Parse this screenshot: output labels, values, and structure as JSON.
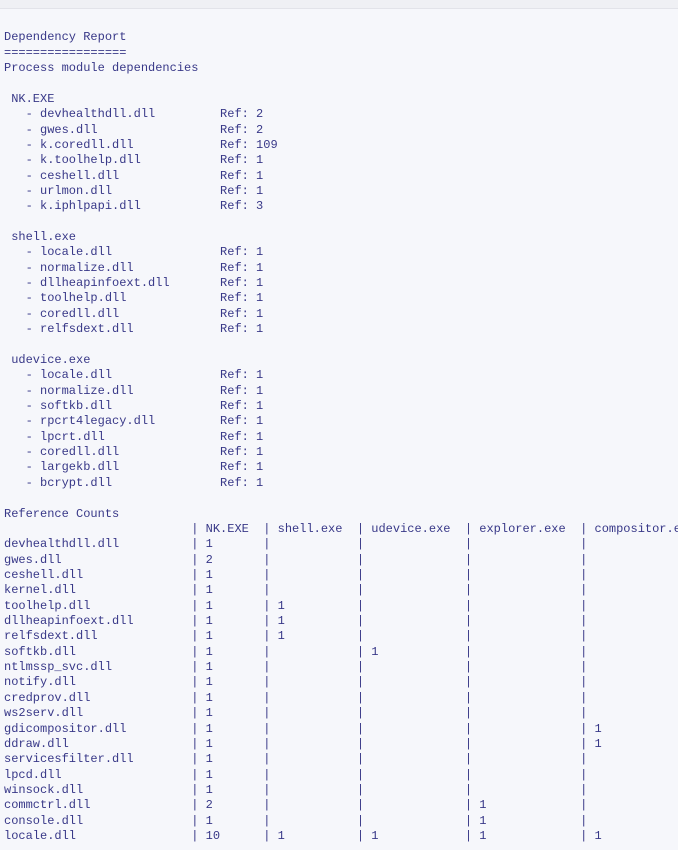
{
  "header": {
    "title": "Dependency Report",
    "divider": "=================",
    "subtitle": "Process module dependencies"
  },
  "processes": [
    {
      "name": "NK.EXE",
      "modules": [
        {
          "name": "devhealthdll.dll",
          "ref": 2
        },
        {
          "name": "gwes.dll",
          "ref": 2
        },
        {
          "name": "k.coredll.dll",
          "ref": 109
        },
        {
          "name": "k.toolhelp.dll",
          "ref": 1
        },
        {
          "name": "ceshell.dll",
          "ref": 1
        },
        {
          "name": "urlmon.dll",
          "ref": 1
        },
        {
          "name": "k.iphlpapi.dll",
          "ref": 3
        }
      ]
    },
    {
      "name": "shell.exe",
      "modules": [
        {
          "name": "locale.dll",
          "ref": 1
        },
        {
          "name": "normalize.dll",
          "ref": 1
        },
        {
          "name": "dllheapinfoext.dll",
          "ref": 1
        },
        {
          "name": "toolhelp.dll",
          "ref": 1
        },
        {
          "name": "coredll.dll",
          "ref": 1
        },
        {
          "name": "relfsdext.dll",
          "ref": 1
        }
      ]
    },
    {
      "name": "udevice.exe",
      "modules": [
        {
          "name": "locale.dll",
          "ref": 1
        },
        {
          "name": "normalize.dll",
          "ref": 1
        },
        {
          "name": "softkb.dll",
          "ref": 1
        },
        {
          "name": "rpcrt4legacy.dll",
          "ref": 1
        },
        {
          "name": "lpcrt.dll",
          "ref": 1
        },
        {
          "name": "coredll.dll",
          "ref": 1
        },
        {
          "name": "largekb.dll",
          "ref": 1
        },
        {
          "name": "bcrypt.dll",
          "ref": 1
        }
      ]
    }
  ],
  "refcounts": {
    "title": "Reference Counts",
    "columns": [
      "NK.EXE",
      "shell.exe",
      "udevice.exe",
      "explorer.exe",
      "compositor.exe"
    ],
    "rows": [
      {
        "name": "devhealthdll.dll",
        "counts": [
          1,
          null,
          null,
          null,
          null
        ]
      },
      {
        "name": "gwes.dll",
        "counts": [
          2,
          null,
          null,
          null,
          null
        ]
      },
      {
        "name": "ceshell.dll",
        "counts": [
          1,
          null,
          null,
          null,
          null
        ]
      },
      {
        "name": "kernel.dll",
        "counts": [
          1,
          null,
          null,
          null,
          null
        ]
      },
      {
        "name": "toolhelp.dll",
        "counts": [
          1,
          1,
          null,
          null,
          null
        ]
      },
      {
        "name": "dllheapinfoext.dll",
        "counts": [
          1,
          1,
          null,
          null,
          null
        ]
      },
      {
        "name": "relfsdext.dll",
        "counts": [
          1,
          1,
          null,
          null,
          null
        ]
      },
      {
        "name": "softkb.dll",
        "counts": [
          1,
          null,
          1,
          null,
          null
        ]
      },
      {
        "name": "ntlmssp_svc.dll",
        "counts": [
          1,
          null,
          null,
          null,
          null
        ]
      },
      {
        "name": "notify.dll",
        "counts": [
          1,
          null,
          null,
          null,
          null
        ]
      },
      {
        "name": "credprov.dll",
        "counts": [
          1,
          null,
          null,
          null,
          null
        ]
      },
      {
        "name": "ws2serv.dll",
        "counts": [
          1,
          null,
          null,
          null,
          null
        ]
      },
      {
        "name": "gdicompositor.dll",
        "counts": [
          1,
          null,
          null,
          null,
          1
        ]
      },
      {
        "name": "ddraw.dll",
        "counts": [
          1,
          null,
          null,
          null,
          1
        ]
      },
      {
        "name": "servicesfilter.dll",
        "counts": [
          1,
          null,
          null,
          null,
          null
        ]
      },
      {
        "name": "lpcd.dll",
        "counts": [
          1,
          null,
          null,
          null,
          null
        ]
      },
      {
        "name": "winsock.dll",
        "counts": [
          1,
          null,
          null,
          null,
          null
        ]
      },
      {
        "name": "commctrl.dll",
        "counts": [
          2,
          null,
          null,
          1,
          null
        ]
      },
      {
        "name": "console.dll",
        "counts": [
          1,
          null,
          null,
          1,
          null
        ]
      },
      {
        "name": "locale.dll",
        "counts": [
          10,
          1,
          1,
          1,
          1
        ]
      }
    ]
  },
  "layout": {
    "modNameCol": 30,
    "rowNameCol": 26,
    "countColWidths": [
      9,
      12,
      14,
      15,
      17
    ]
  }
}
